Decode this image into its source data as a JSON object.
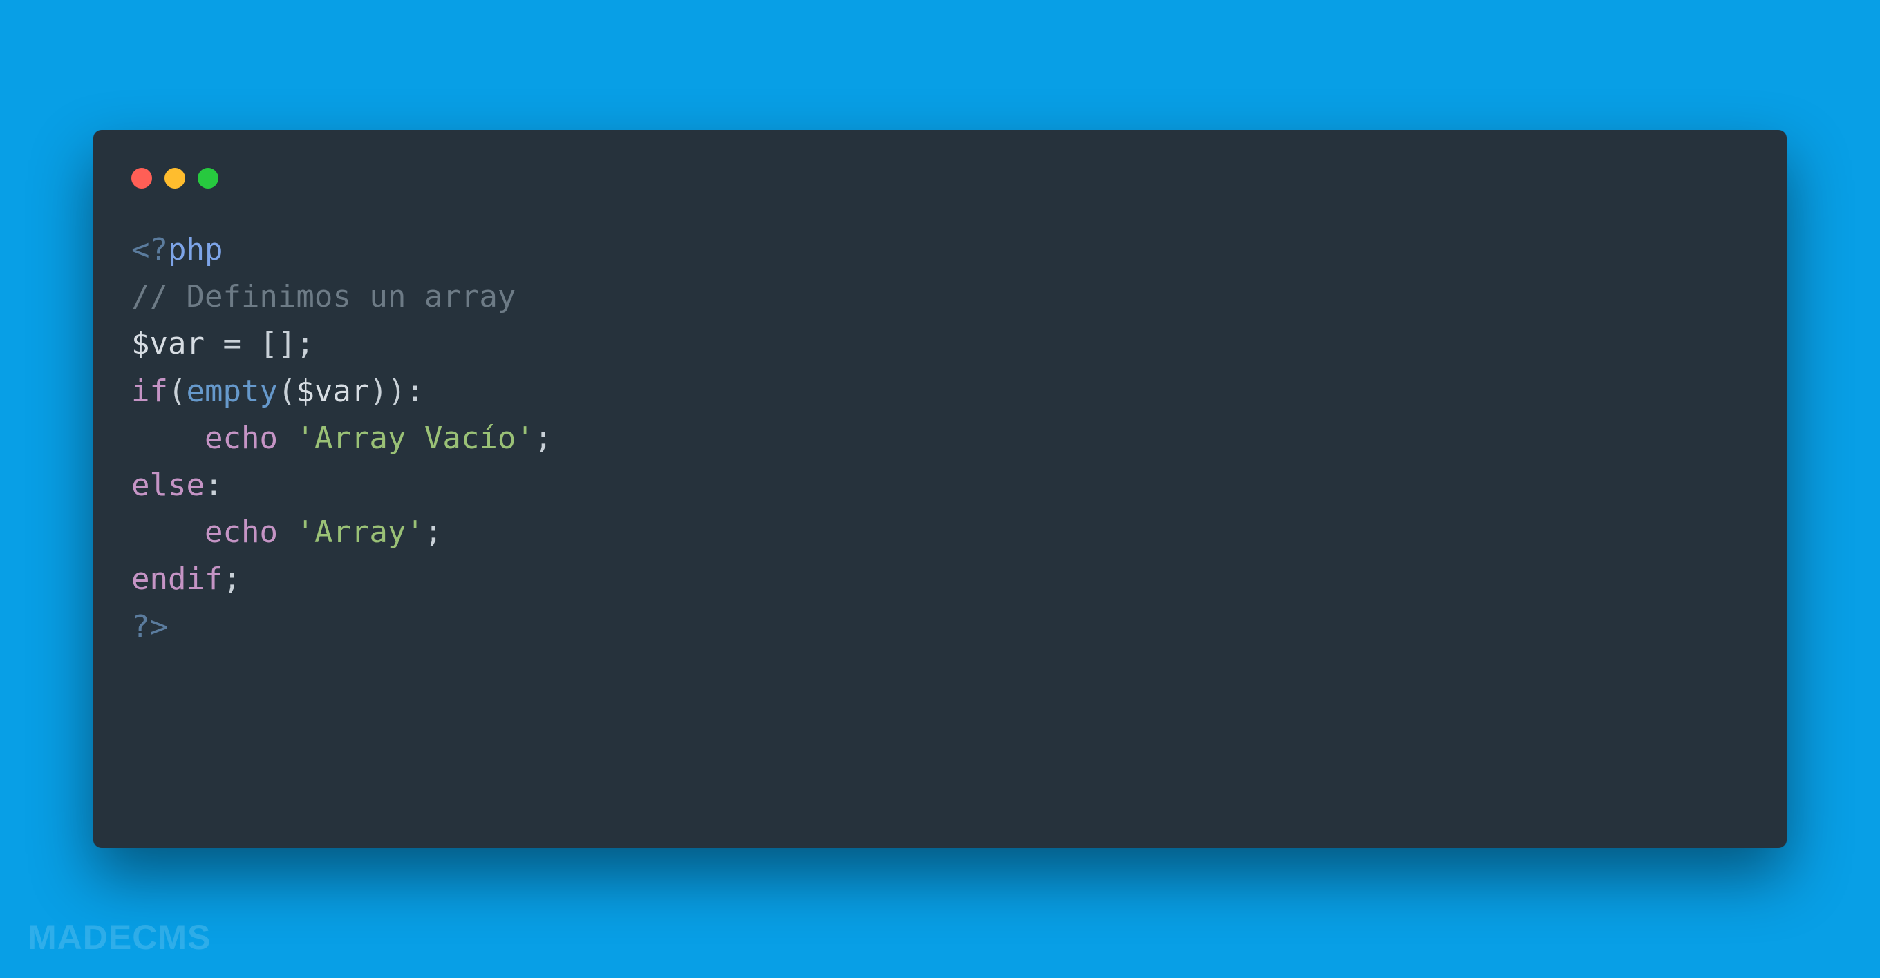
{
  "window": {
    "traffic": {
      "red": "close",
      "yellow": "minimize",
      "green": "zoom"
    }
  },
  "code": {
    "open_bracket": "<?",
    "php": "php",
    "comment": "// Definimos un array",
    "var": "$var",
    "assign": " = [];",
    "if_kw": "if",
    "empty_fn": "empty",
    "open_paren1": "(",
    "open_paren2": "(",
    "close_paren1": ")",
    "close_paren2": ")",
    "colon1": ":",
    "echo1": "echo",
    "str1_q1": "'",
    "str1_text": "Array Vacío",
    "str1_q2": "'",
    "semi1": ";",
    "else_kw": "else",
    "colon2": ":",
    "echo2": "echo",
    "str2_q1": "'",
    "str2_text": "Array",
    "str2_q2": "'",
    "semi2": ";",
    "endif_kw": "endif",
    "semi3": ";",
    "close_bracket": "?>",
    "indent": "    "
  },
  "watermark": "MADECMS"
}
